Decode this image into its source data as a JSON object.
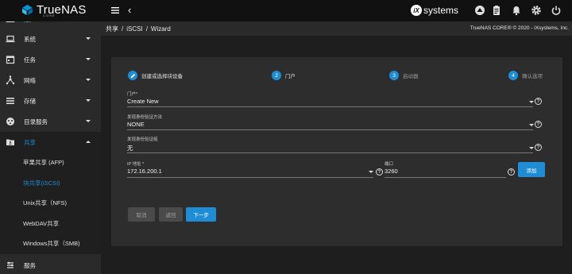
{
  "app": {
    "logo_text": "TrueNAS",
    "logo_sub": "CORE",
    "brand_text": "systems",
    "brand_mark": "iX",
    "back_glyph": "‹"
  },
  "sidebar": {
    "items": [
      {
        "label": "账户",
        "icon": "people-icon"
      },
      {
        "label": "系统",
        "icon": "laptop-icon"
      },
      {
        "label": "任务",
        "icon": "calendar-icon"
      },
      {
        "label": "网络",
        "icon": "network-icon"
      },
      {
        "label": "存储",
        "icon": "storage-icon"
      },
      {
        "label": "目录服务",
        "icon": "directory-icon"
      },
      {
        "label": "共享",
        "icon": "folder-share-icon"
      }
    ],
    "sub_items": [
      {
        "label": "苹果共享 (AFP)"
      },
      {
        "label": "块共享(iSCSI)"
      },
      {
        "label": "Unix共享（NFS)"
      },
      {
        "label": "WebDAV共享"
      },
      {
        "label": "Windows共享（SMB)"
      }
    ],
    "bottom_label": "服务"
  },
  "breadcrumb": {
    "items": [
      "共享",
      "iSCSI",
      "Wizard"
    ],
    "separator": "/"
  },
  "copyright": "TrueNAS CORE® © 2020 - iXsystems, Inc.",
  "wizard": {
    "steps": [
      {
        "num": "",
        "label": "创建或选择块设备"
      },
      {
        "num": "2",
        "label": "门户"
      },
      {
        "num": "3",
        "label": "启动器"
      },
      {
        "num": "4",
        "label": "确认选项"
      }
    ],
    "fields": {
      "portal": {
        "label": "门户*",
        "value": "Create New"
      },
      "discovery_auth": {
        "label": "发现身份验证方法",
        "value": "NONE"
      },
      "discovery_group": {
        "label": "发现身份验证组",
        "value": "无"
      },
      "ip": {
        "label": "IP 地址 *",
        "value": "172.16.200.1"
      },
      "port": {
        "label": "端口",
        "value": "3260"
      }
    },
    "help_glyph": "?",
    "add_button": "添加",
    "buttons": {
      "cancel": "取消",
      "back": "返回",
      "next": "下一步"
    }
  },
  "colors": {
    "accent": "#1f8dd6",
    "topbar": "#111111",
    "sidebar": "#2a2a2a",
    "card": "#2d2d2d"
  }
}
